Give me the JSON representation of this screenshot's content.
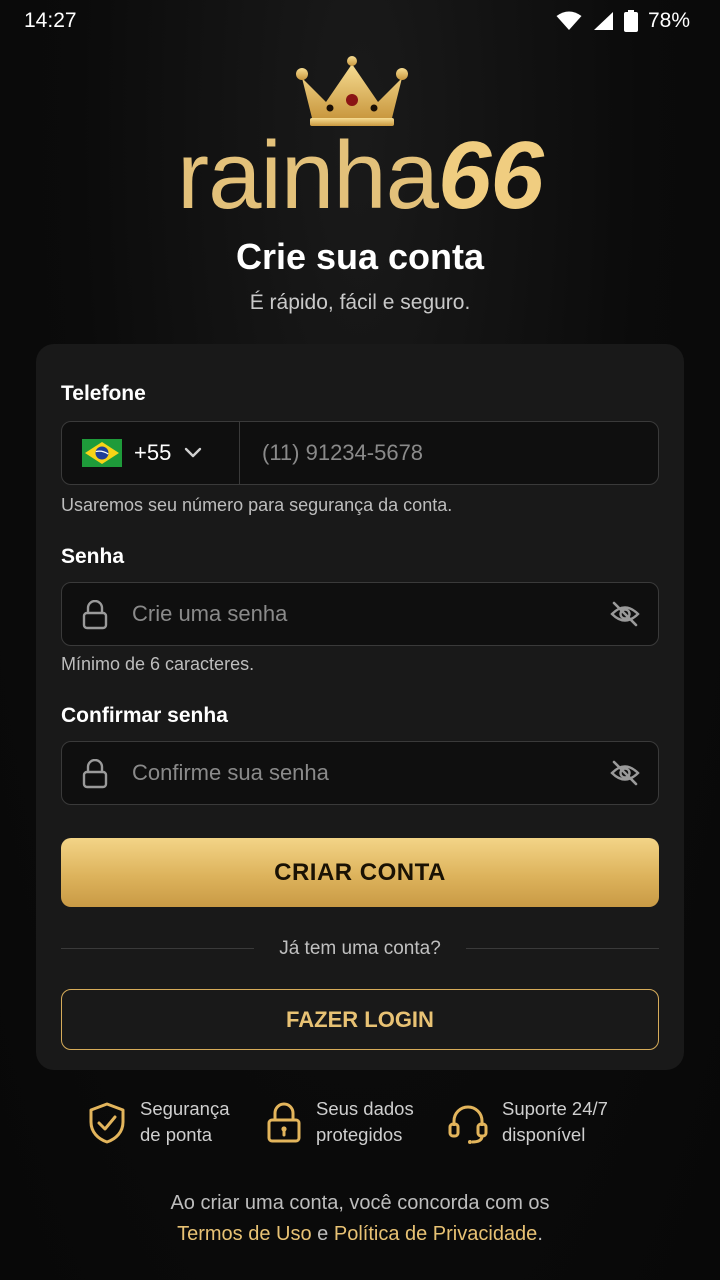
{
  "status_bar": {
    "time": "14:27",
    "battery": "78%"
  },
  "logo": {
    "word": "rainha",
    "number": "66"
  },
  "header": {
    "title": "Crie sua conta",
    "subtitle": "É rápido, fácil e seguro."
  },
  "form": {
    "phone": {
      "label": "Telefone",
      "country_code": "+55",
      "placeholder": "(11) 91234-5678",
      "value": "",
      "helper": "Usaremos seu número para segurança da conta."
    },
    "password": {
      "label": "Senha",
      "placeholder": "Crie uma senha",
      "value": "",
      "helper": "Mínimo de 6 caracteres."
    },
    "confirm_password": {
      "label": "Confirmar senha",
      "placeholder": "Confirme sua senha",
      "value": ""
    },
    "submit_label": "CRIAR CONTA",
    "divider_text": "Já tem uma conta?",
    "login_label": "FAZER LOGIN"
  },
  "features": [
    {
      "icon": "shield-check-icon",
      "line1": "Segurança",
      "line2": "de ponta"
    },
    {
      "icon": "lock-icon",
      "line1": "Seus dados",
      "line2": "protegidos"
    },
    {
      "icon": "headset-icon",
      "line1": "Suporte 24/7",
      "line2": "disponível"
    }
  ],
  "footer": {
    "text1": "Ao criar uma conta, você concorda com os",
    "terms_link": "Termos de Uso",
    "and": "e",
    "privacy_link": "Política de Privacidade",
    "period": "."
  },
  "colors": {
    "accent_gold": "#e3c17a",
    "background": "#0b0b0b",
    "card": "#191919"
  }
}
